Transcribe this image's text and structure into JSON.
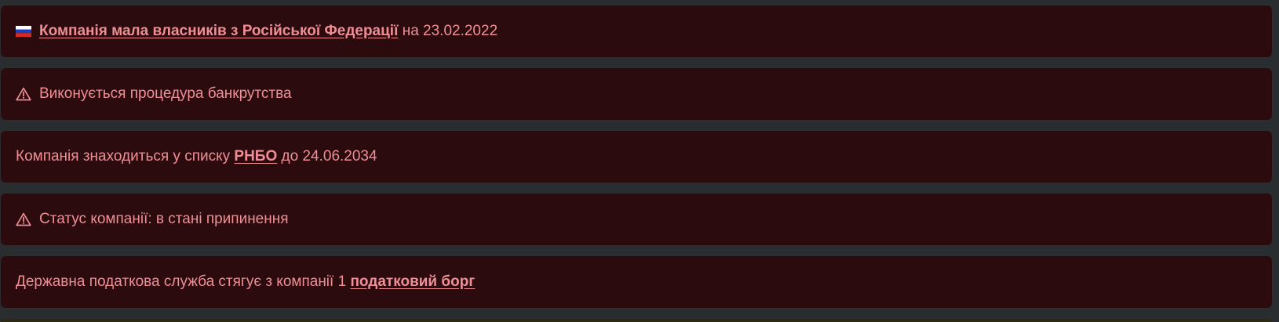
{
  "alerts": [
    {
      "icon": "russia-flag-icon",
      "link": "Компанія мала власників з Російської Федерації",
      "suffix": " на 23.02.2022"
    },
    {
      "icon": "warning-triangle-icon",
      "text": "Виконується процедура банкрутства"
    },
    {
      "prefix": "Компанія знаходиться у списку ",
      "link": "РНБО",
      "suffix": " до 24.06.2034"
    },
    {
      "icon": "warning-triangle-icon",
      "text": "Статус компанії: в стані припинення"
    },
    {
      "prefix": "Державна податкова служба стягує з компанії 1 ",
      "link": "податковий борг"
    }
  ],
  "colors": {
    "page_background": "#2a2d30",
    "alert_background": "#2b0b0e",
    "alert_text": "#f08e96",
    "flag_white": "#ffffff",
    "flag_blue": "#1f3fbf",
    "flag_red": "#d52b1e"
  }
}
